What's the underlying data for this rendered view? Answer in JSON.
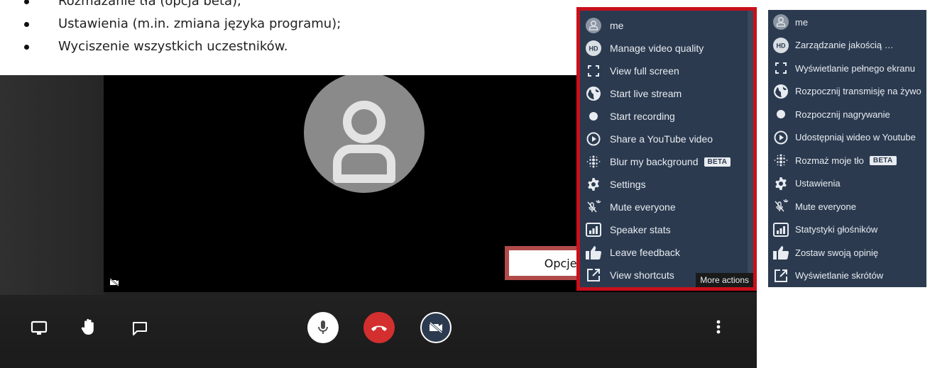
{
  "bullets": [
    "Rozmazanie tła (opcja beta);",
    "Ustawienia (m.in. zmiana języka programu);",
    "Wyciszenie wszystkich uczestników."
  ],
  "callout": {
    "label": "Opcje dodatkowe"
  },
  "menu_en": {
    "items": [
      {
        "label": "me",
        "icon": "user-avatar-icon"
      },
      {
        "label": "Manage video quality",
        "icon": "hd-icon"
      },
      {
        "label": "View full screen",
        "icon": "fullscreen-icon"
      },
      {
        "label": "Start live stream",
        "icon": "globe-icon"
      },
      {
        "label": "Start recording",
        "icon": "record-icon"
      },
      {
        "label": "Share a YouTube video",
        "icon": "play-circle-icon"
      },
      {
        "label": "Blur my background",
        "icon": "blur-icon",
        "badge": "BETA"
      },
      {
        "label": "Settings",
        "icon": "gear-icon"
      },
      {
        "label": "Mute everyone",
        "icon": "mute-everyone-icon"
      },
      {
        "label": "Speaker stats",
        "icon": "stats-icon"
      },
      {
        "label": "Leave feedback",
        "icon": "thumbs-up-icon"
      },
      {
        "label": "View shortcuts",
        "icon": "external-link-icon"
      }
    ],
    "tooltip": "More actions"
  },
  "menu_pl": {
    "items": [
      {
        "label": "me",
        "icon": "user-avatar-icon"
      },
      {
        "label": "Zarządzanie jakością …",
        "icon": "hd-icon"
      },
      {
        "label": "Wyświetlanie pełnego ekranu",
        "icon": "fullscreen-icon"
      },
      {
        "label": "Rozpocznij transmisję na żywo",
        "icon": "globe-icon"
      },
      {
        "label": "Rozpocznij nagrywanie",
        "icon": "record-icon"
      },
      {
        "label": "Udostępniaj wideo w Youtube",
        "icon": "play-circle-icon"
      },
      {
        "label": "Rozmaż moje tło",
        "icon": "blur-icon",
        "badge": "BETA"
      },
      {
        "label": "Ustawienia",
        "icon": "gear-icon"
      },
      {
        "label": "Mute everyone",
        "icon": "mute-everyone-icon"
      },
      {
        "label": "Statystyki głośników",
        "icon": "stats-icon"
      },
      {
        "label": "Zostaw swoją opinię",
        "icon": "thumbs-up-icon"
      },
      {
        "label": "Wyświetlanie skrótów",
        "icon": "external-link-icon"
      }
    ]
  },
  "colors": {
    "menu_bg": "#2b3a4f",
    "highlight_red": "#c8101c",
    "hangup_red": "#d32f2f",
    "callout_border": "#b24a4a"
  }
}
